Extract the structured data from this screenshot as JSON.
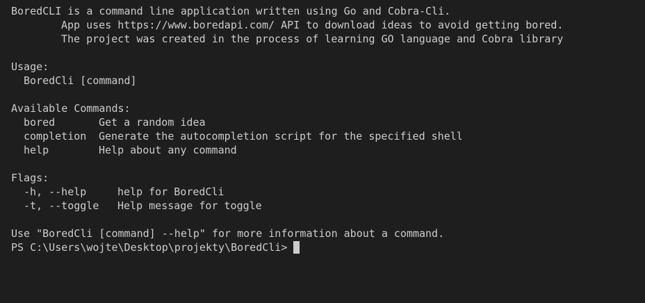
{
  "intro": {
    "line1": "BoredCLI is a command line application written using Go and Cobra-Cli.",
    "line2": "App uses https://www.boredapi.com/ API to download ideas to avoid getting bored.",
    "line3": "The project was created in the process of learning GO language and Cobra library"
  },
  "usage": {
    "header": "Usage:",
    "text": "BoredCli [command]"
  },
  "commands": {
    "header": "Available Commands:",
    "items": [
      {
        "name": "bored",
        "desc": "Get a random idea"
      },
      {
        "name": "completion",
        "desc": "Generate the autocompletion script for the specified shell"
      },
      {
        "name": "help",
        "desc": "Help about any command"
      }
    ]
  },
  "flags": {
    "header": "Flags:",
    "items": [
      {
        "name": "-h, --help",
        "desc": "help for BoredCli"
      },
      {
        "name": "-t, --toggle",
        "desc": "Help message for toggle"
      }
    ]
  },
  "footer": {
    "hint": "Use \"BoredCli [command] --help\" for more information about a command.",
    "prompt": "PS C:\\Users\\wojte\\Desktop\\projekty\\BoredCli>"
  },
  "colors": {
    "background": "#1e1e1e",
    "text": "#cccccc"
  }
}
